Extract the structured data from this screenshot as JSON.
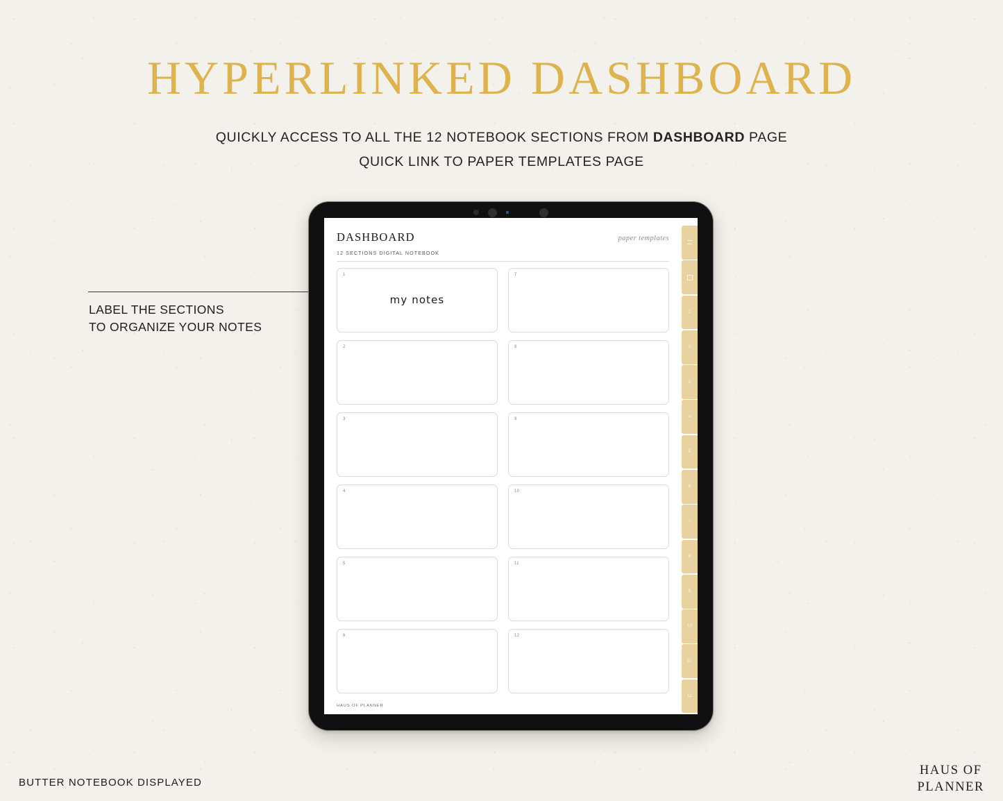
{
  "header": {
    "title": "HYPERLINKED DASHBOARD",
    "subtitle_1_pre": "QUICKLY ACCESS TO ALL THE 12 NOTEBOOK SECTIONS FROM ",
    "subtitle_1_bold": "DASHBOARD",
    "subtitle_1_post": " PAGE",
    "subtitle_2": "QUICK LINK TO PAPER TEMPLATES PAGE",
    "accent_color": "#deb24c"
  },
  "annotation": {
    "line_1": "LABEL THE SECTIONS",
    "line_2": "TO ORGANIZE YOUR NOTES"
  },
  "footer": {
    "caption": "BUTTER NOTEBOOK DISPLAYED",
    "logo_line_1": "HAUS OF",
    "logo_line_2": "PLANNER"
  },
  "device": {
    "frame_color": "#111010",
    "screen_bg": "#ffffff"
  },
  "page": {
    "title": "DASHBOARD",
    "paper_templates_link": "paper templates",
    "subtitle": "12 SECTIONS DIGITAL NOTEBOOK",
    "footer_brand": "HAUS OF PLANNER",
    "cards": [
      {
        "number": "1",
        "label": "my notes"
      },
      {
        "number": "7",
        "label": ""
      },
      {
        "number": "2",
        "label": ""
      },
      {
        "number": "8",
        "label": ""
      },
      {
        "number": "3",
        "label": ""
      },
      {
        "number": "9",
        "label": ""
      },
      {
        "number": "4",
        "label": ""
      },
      {
        "number": "10",
        "label": ""
      },
      {
        "number": "5",
        "label": ""
      },
      {
        "number": "11",
        "label": ""
      },
      {
        "number": "6",
        "label": ""
      },
      {
        "number": "12",
        "label": ""
      }
    ]
  },
  "tabstrip": {
    "tab_color": "#e8d3a0",
    "tabs": [
      {
        "label": "",
        "icon": "menu-icon"
      },
      {
        "label": "",
        "icon": "square-icon"
      },
      {
        "label": "1",
        "icon": ""
      },
      {
        "label": "2",
        "icon": ""
      },
      {
        "label": "3",
        "icon": ""
      },
      {
        "label": "4",
        "icon": ""
      },
      {
        "label": "5",
        "icon": ""
      },
      {
        "label": "6",
        "icon": ""
      },
      {
        "label": "7",
        "icon": ""
      },
      {
        "label": "8",
        "icon": ""
      },
      {
        "label": "9",
        "icon": ""
      },
      {
        "label": "10",
        "icon": ""
      },
      {
        "label": "11",
        "icon": ""
      },
      {
        "label": "12",
        "icon": ""
      }
    ]
  }
}
